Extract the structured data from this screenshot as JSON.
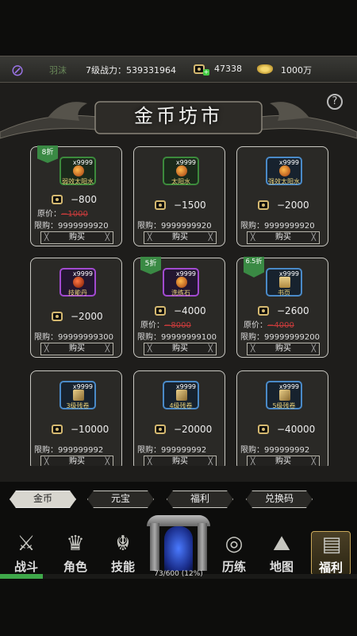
{
  "topbar": {
    "player_name": "羽沫",
    "power_label": "7级战力：",
    "power_value": "539331964",
    "power_text": "7级战力：539331964",
    "gold": "47338",
    "yuanbao": "1000万"
  },
  "shop": {
    "title": "金币坊市",
    "help": "?",
    "buy_label": "购买",
    "orig_label": "原价：",
    "limit_label": "限购："
  },
  "items": [
    {
      "name": "弱效太阳水",
      "qty": "x9999",
      "price": "−800",
      "orig": "−1000",
      "limit": "限购：9999999920",
      "discount": "8折",
      "frame": "green",
      "img": "potion"
    },
    {
      "name": "太阳水",
      "qty": "x9999",
      "price": "−1500",
      "orig": "",
      "limit": "限购：9999999920",
      "discount": "",
      "frame": "green",
      "img": "potion"
    },
    {
      "name": "强效太阳水",
      "qty": "x9999",
      "price": "−2000",
      "orig": "",
      "limit": "限购：9999999920",
      "discount": "",
      "frame": "blue",
      "img": "potion"
    },
    {
      "name": "技能丹",
      "qty": "x9999",
      "price": "−2000",
      "orig": "",
      "limit": "限购：99999999300",
      "discount": "",
      "frame": "purple",
      "img": "red"
    },
    {
      "name": "洗练石",
      "qty": "x9999",
      "price": "−4000",
      "orig": "−8000",
      "limit": "限购：99999999100",
      "discount": "5折",
      "frame": "purple",
      "img": "potion"
    },
    {
      "name": "书页",
      "qty": "x9999",
      "price": "−2600",
      "orig": "−4000",
      "limit": "限购：99999999200",
      "discount": "6.5折",
      "frame": "blue",
      "img": "scroll"
    },
    {
      "name": "3级残卷",
      "qty": "x9999",
      "price": "−10000",
      "orig": "",
      "limit": "限购：999999992",
      "discount": "",
      "frame": "blue",
      "img": "scroll2"
    },
    {
      "name": "4级残卷",
      "qty": "x9999",
      "price": "−20000",
      "orig": "",
      "limit": "限购：999999992",
      "discount": "",
      "frame": "blue",
      "img": "scroll2"
    },
    {
      "name": "5级残卷",
      "qty": "x9999",
      "price": "−40000",
      "orig": "",
      "limit": "限购：999999992",
      "discount": "",
      "frame": "blue",
      "img": "scroll2"
    }
  ],
  "tabs": [
    "金币",
    "元宝",
    "福利",
    "兑换码"
  ],
  "nav": [
    "战斗",
    "角色",
    "技能",
    "历练",
    "地图",
    "福利"
  ],
  "xp": {
    "text": "73/600 (12%)",
    "percent": 12
  }
}
